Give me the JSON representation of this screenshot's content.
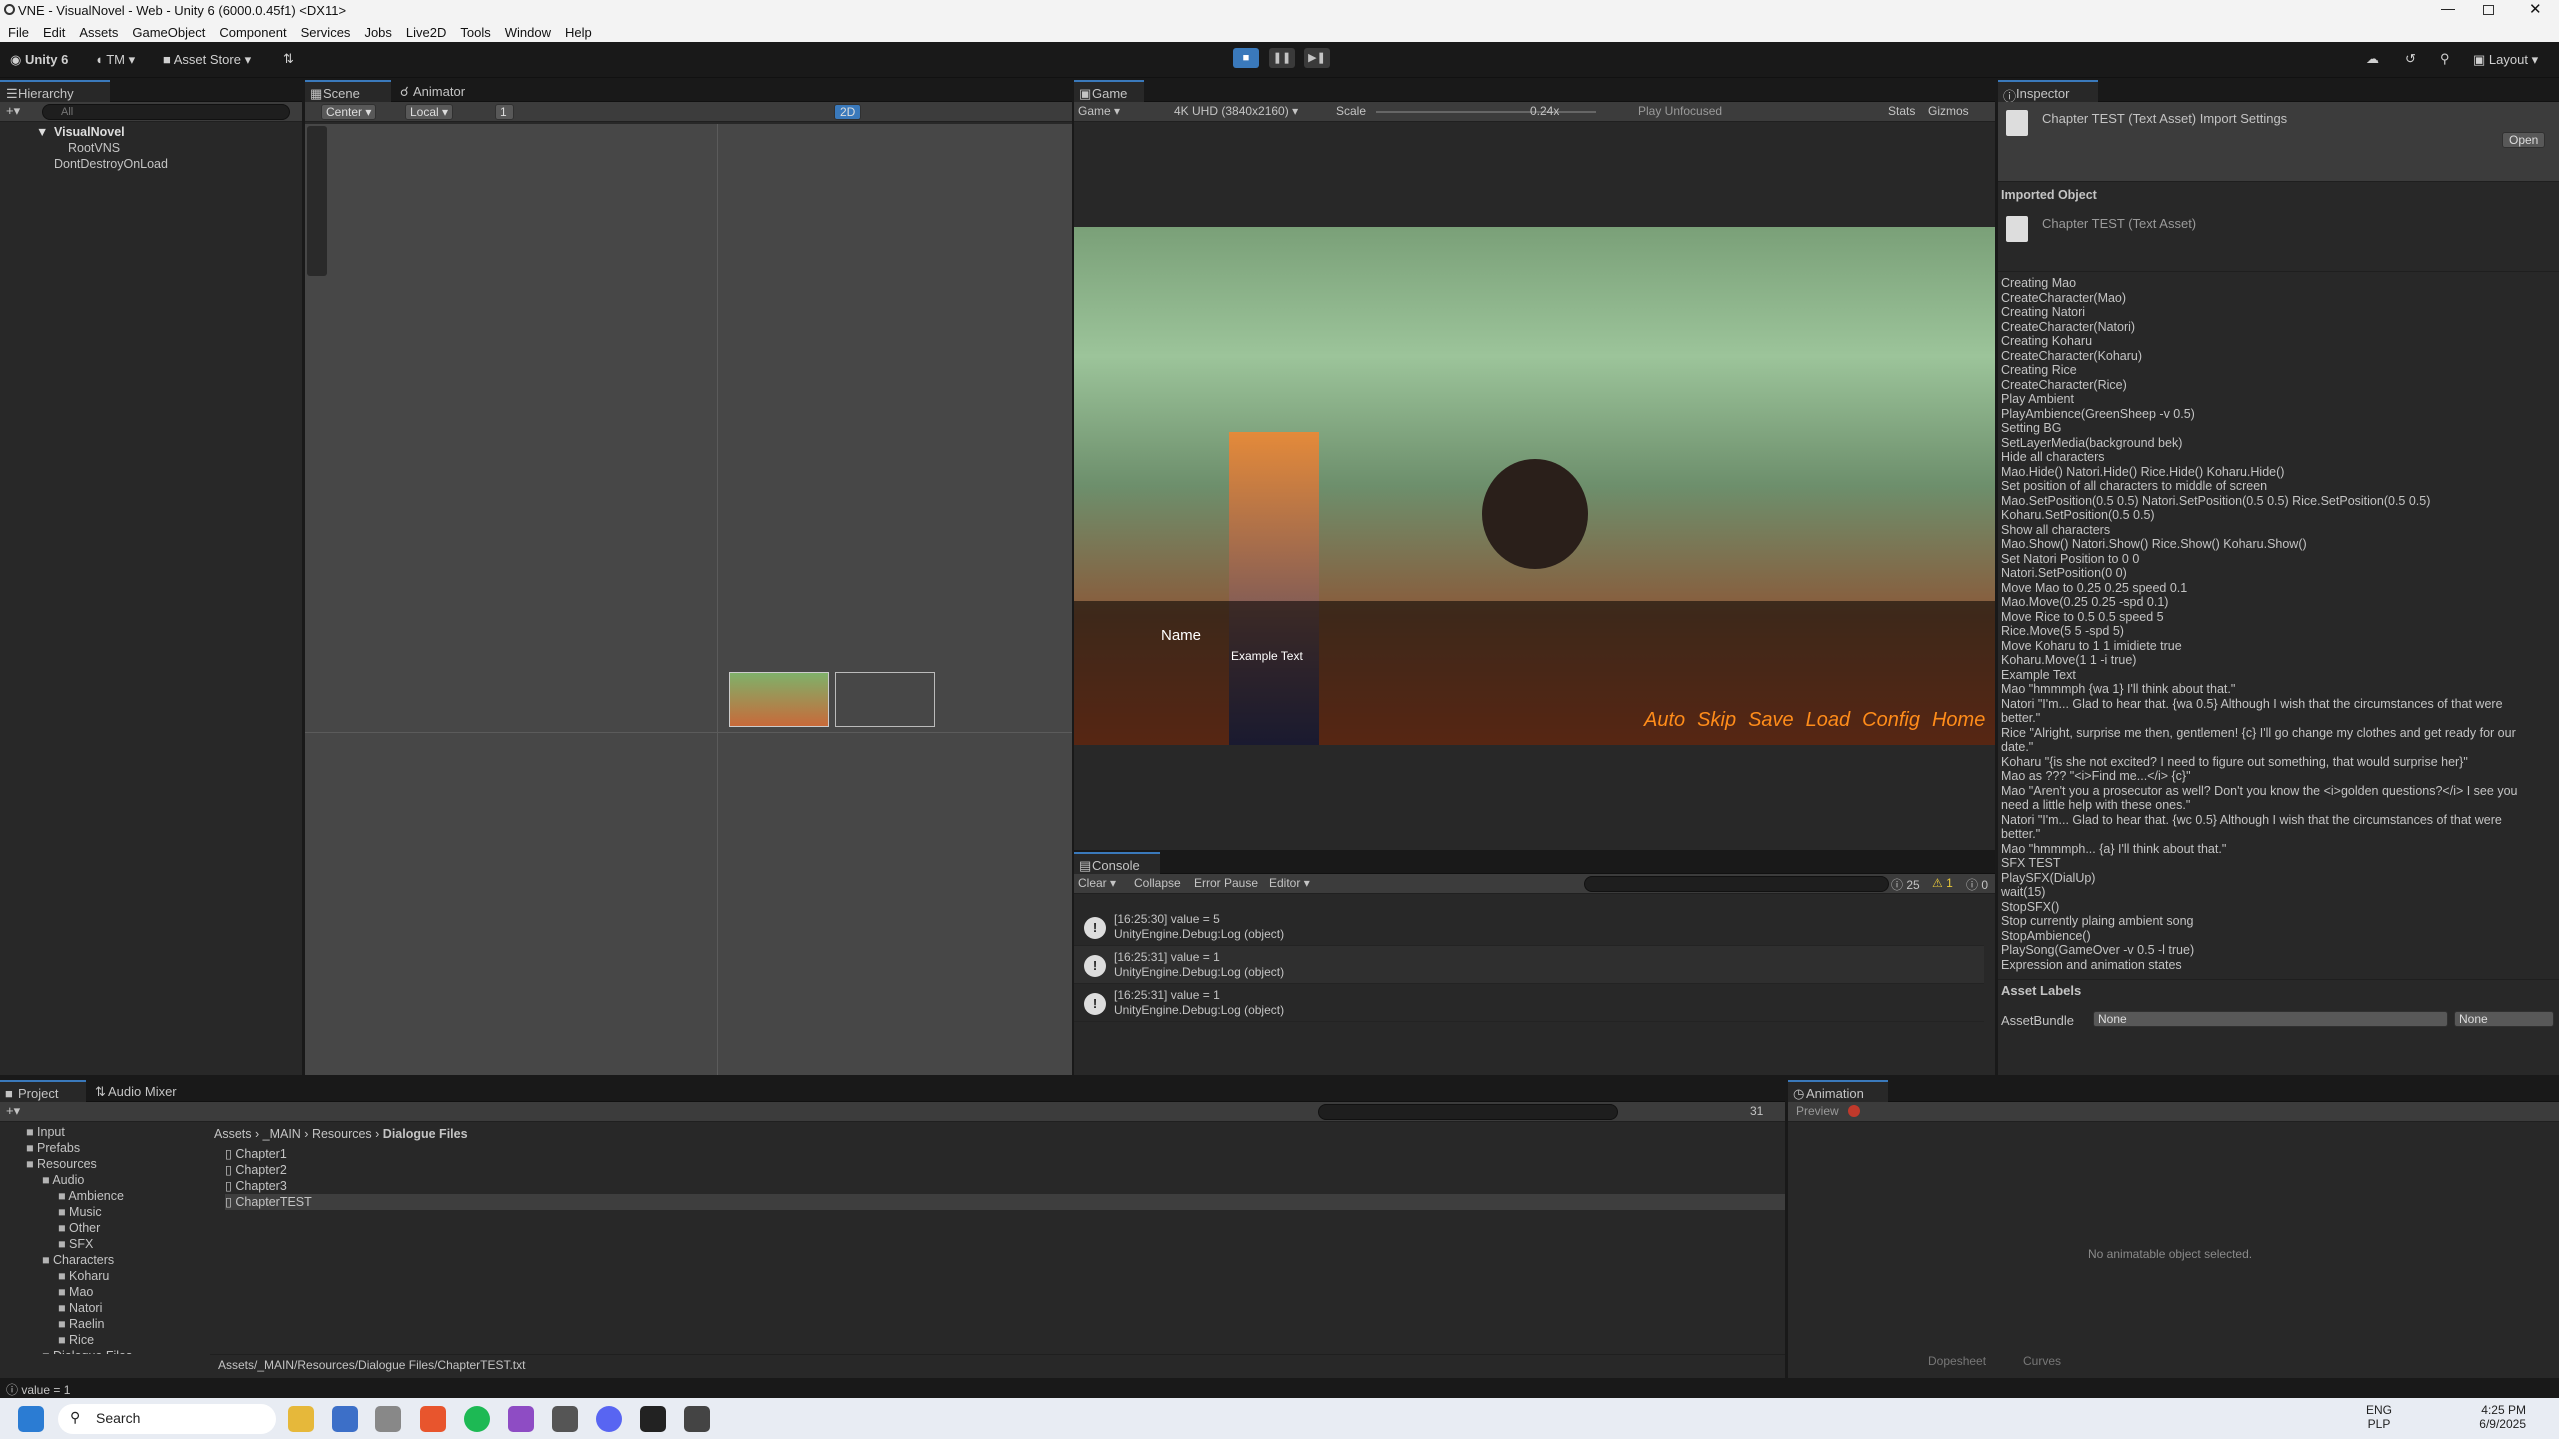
{
  "window": {
    "title": "VNE - VisualNovel - Web - Unity 6 (6000.0.45f1) <DX11>"
  },
  "menu": [
    "File",
    "Edit",
    "Assets",
    "GameObject",
    "Component",
    "Services",
    "Jobs",
    "Live2D",
    "Tools",
    "Window",
    "Help"
  ],
  "toolbar": {
    "account": "Unity 6",
    "user": "TM",
    "asset_store": "Asset Store",
    "layout": "Layout"
  },
  "hierarchy": {
    "tab": "Hierarchy",
    "search_placeholder": "All",
    "items": [
      "VisualNovel",
      "RootVNS",
      "DontDestroyOnLoad"
    ]
  },
  "scene": {
    "tabs": [
      "Scene",
      "Animator"
    ],
    "pivot": "Center",
    "space": "Local",
    "snap": "1",
    "mode2d": "2D"
  },
  "game": {
    "tab": "Game",
    "display": "Game",
    "resolution": "4K UHD (3840x2160)",
    "scale_label": "Scale",
    "scale_value": "0.24x",
    "play_focus": "Play Unfocused",
    "stats": "Stats",
    "gizmos": "Gizmos",
    "name_label": "Name",
    "example_text": "Example Text",
    "menu_buttons": [
      "Auto",
      "Skip",
      "Save",
      "Load",
      "Config",
      "Home"
    ]
  },
  "console": {
    "tab": "Console",
    "clear": "Clear",
    "collapse": "Collapse",
    "error_pause": "Error Pause",
    "editor": "Editor",
    "counts": {
      "log": "25",
      "warn": "1",
      "error": "0"
    },
    "entries": [
      {
        "line1": "[16:25:30] value = 5",
        "line2": "UnityEngine.Debug:Log (object)"
      },
      {
        "line1": "[16:25:31] value = 1",
        "line2": "UnityEngine.Debug:Log (object)"
      },
      {
        "line1": "[16:25:31] value = 1",
        "line2": "UnityEngine.Debug:Log (object)"
      }
    ]
  },
  "inspector": {
    "tab": "Inspector",
    "header": "Chapter TEST (Text Asset) Import Settings",
    "open": "Open",
    "imported_object": "Imported Object",
    "object_name": "Chapter TEST (Text Asset)",
    "lines": [
      "Creating Mao",
      "CreateCharacter(Mao)",
      "Creating Natori",
      "CreateCharacter(Natori)",
      "Creating Koharu",
      "CreateCharacter(Koharu)",
      "Creating Rice",
      "CreateCharacter(Rice)",
      "Play Ambient",
      "PlayAmbience(GreenSheep -v 0.5)",
      "Setting BG",
      "SetLayerMedia(background bek)",
      "Hide all characters",
      "Mao.Hide() Natori.Hide() Rice.Hide() Koharu.Hide()",
      "Set position of all characters to middle of screen",
      "Mao.SetPosition(0.5 0.5) Natori.SetPosition(0.5 0.5) Rice.SetPosition(0.5 0.5)",
      "Koharu.SetPosition(0.5 0.5)",
      "Show all characters",
      "Mao.Show() Natori.Show() Rice.Show() Koharu.Show()",
      "Set Natori Position to 0 0",
      "Natori.SetPosition(0 0)",
      "Move Mao to 0.25 0.25 speed 0.1",
      "Mao.Move(0.25 0.25 -spd 0.1)",
      "Move Rice to 0.5 0.5 speed 5",
      "Rice.Move(5 5 -spd 5)",
      "Move Koharu to 1 1 imidiete true",
      "Koharu.Move(1 1 -i true)",
      "Example Text",
      "Mao \"hmmmph {wa 1} I'll think about that.\"",
      "Natori \"I'm... Glad to hear that. {wa 0.5} Although I wish that the circumstances of that were",
      "better.\"",
      "Rice \"Alright, surprise me then, gentlemen! {c} I'll go change my clothes and get ready for our",
      "date.\"",
      "Koharu \"{is she not excited? I need to figure out something, that would surprise her}\"",
      "Mao as ??? \"<i>Find me...</i> {c}\"",
      "Mao \"Aren't you a prosecutor as well? Don't you know the <i>golden questions?</i> I see you",
      "need a little help with these ones.\"",
      "Natori \"I'm... Glad to hear that. {wc 0.5} Although I wish that the circumstances of that were",
      "better.\"",
      "Mao \"hmmmph... {a} I'll think about that.\"",
      "SFX TEST",
      "PlaySFX(DialUp)",
      "wait(15)",
      "StopSFX()",
      "Stop currently plaing ambient song",
      "StopAmbience()",
      "PlaySong(GameOver -v 0.5 -l true)",
      "Expression and animation states"
    ],
    "asset_labels": "Asset Labels",
    "asset_bundle": "AssetBundle",
    "bundle_value": "None",
    "variant_value": "None"
  },
  "project": {
    "tabs": [
      "Project",
      "Audio Mixer"
    ],
    "breadcrumb": [
      "Assets",
      "_MAIN",
      "Resources",
      "Dialogue Files"
    ],
    "count": "31",
    "tree": [
      {
        "label": "Input",
        "indent": 1
      },
      {
        "label": "Prefabs",
        "indent": 1
      },
      {
        "label": "Resources",
        "indent": 1
      },
      {
        "label": "Audio",
        "indent": 2
      },
      {
        "label": "Ambience",
        "indent": 3
      },
      {
        "label": "Music",
        "indent": 3
      },
      {
        "label": "Other",
        "indent": 3
      },
      {
        "label": "SFX",
        "indent": 3
      },
      {
        "label": "Characters",
        "indent": 2
      },
      {
        "label": "Koharu",
        "indent": 3
      },
      {
        "label": "Mao",
        "indent": 3
      },
      {
        "label": "Natori",
        "indent": 3
      },
      {
        "label": "Raelin",
        "indent": 3
      },
      {
        "label": "Rice",
        "indent": 3
      },
      {
        "label": "Dialogue Files",
        "indent": 2
      }
    ],
    "files": [
      "Chapter1",
      "Chapter2",
      "Chapter3",
      "ChapterTEST"
    ],
    "path": "Assets/_MAIN/Resources/Dialogue Files/ChapterTEST.txt"
  },
  "animation": {
    "tab": "Animation",
    "preview": "Preview",
    "empty": "No animatable object selected.",
    "dopesheet": "Dopesheet",
    "curves": "Curves"
  },
  "status": {
    "text": "value = 1"
  },
  "taskbar": {
    "search": "Search",
    "lang1": "ENG",
    "lang2": "PLP",
    "time": "4:25 PM",
    "date": "6/9/2025"
  }
}
